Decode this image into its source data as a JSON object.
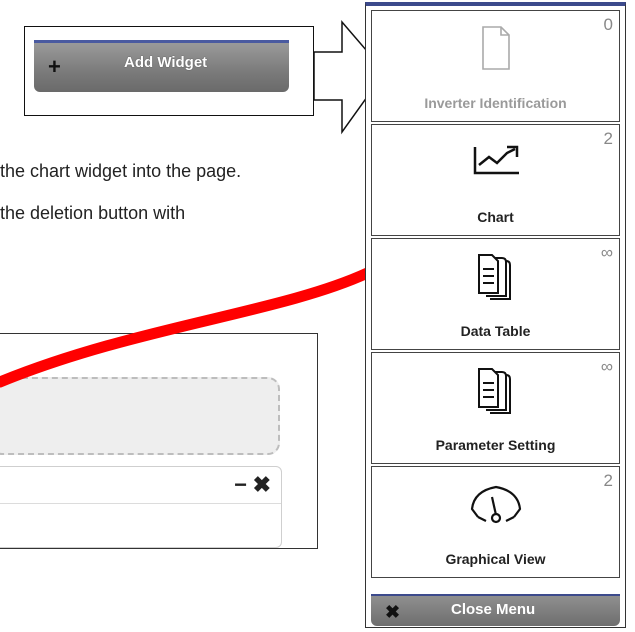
{
  "toolbar": {
    "add_widget_label": "Add Widget",
    "add_widget_icon": "plus-icon"
  },
  "instructions": {
    "line1": "the chart widget into the page.",
    "line2": "the deletion button with"
  },
  "page_widget": {
    "minimize_glyph": "−",
    "close_glyph": "✖"
  },
  "menu": {
    "items": [
      {
        "label": "Inverter Identification",
        "count": "0",
        "icon": "document-icon",
        "enabled": false
      },
      {
        "label": "Chart",
        "count": "2",
        "icon": "line-chart-icon",
        "enabled": true
      },
      {
        "label": "Data Table",
        "count": "∞",
        "icon": "documents-stack-icon",
        "enabled": true
      },
      {
        "label": "Parameter Setting",
        "count": "∞",
        "icon": "documents-stack-icon",
        "enabled": true
      },
      {
        "label": "Graphical View",
        "count": "2",
        "icon": "gauge-icon",
        "enabled": true
      }
    ],
    "close_label": "Close Menu",
    "close_glyph": "✖"
  },
  "colors": {
    "annotation_red": "#ff0000",
    "accent_blue": "#3c4a8c",
    "button_gray": "#7a7a7a"
  }
}
